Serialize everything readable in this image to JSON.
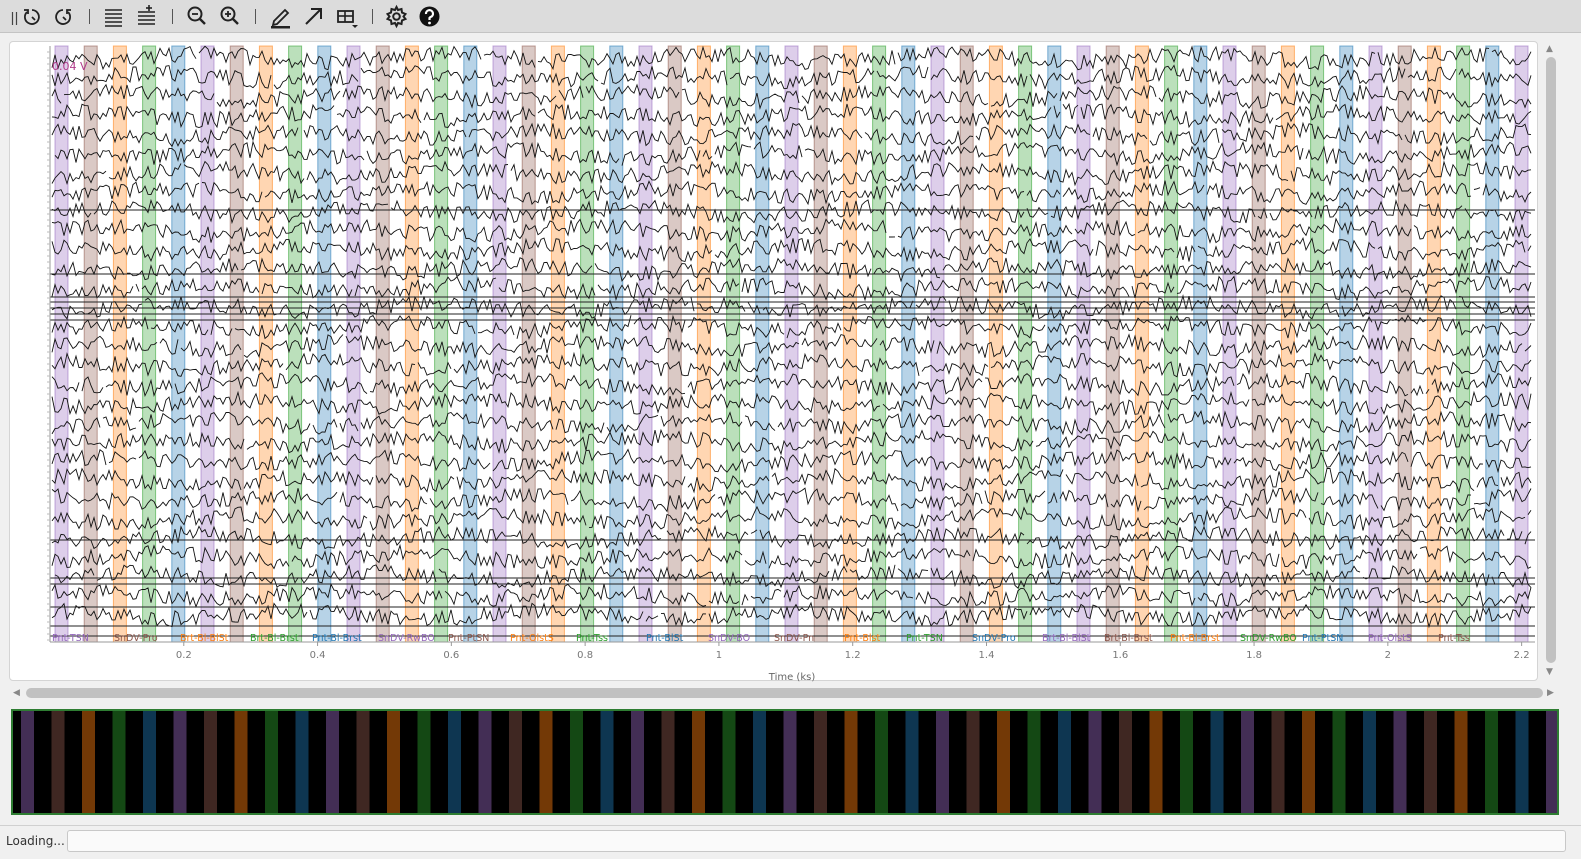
{
  "toolbar": {
    "buttons": [
      {
        "name": "pan-handle-icon",
        "icon": "grip-icon"
      },
      {
        "name": "undo-button",
        "icon": "rotate-left-icon"
      },
      {
        "name": "redo-button",
        "icon": "rotate-right-icon"
      },
      {
        "name": "compress-traces-button",
        "icon": "lines-icon"
      },
      {
        "name": "expand-traces-button",
        "icon": "lines-plus-icon"
      },
      {
        "name": "zoom-out-button",
        "icon": "zoom-out-icon"
      },
      {
        "name": "zoom-in-button",
        "icon": "zoom-in-icon"
      },
      {
        "name": "draw-tool-button",
        "icon": "pencil-icon"
      },
      {
        "name": "arrow-tool-button",
        "icon": "arrow-icon"
      },
      {
        "name": "layout-menu-button",
        "icon": "grid-dropdown-icon"
      },
      {
        "name": "settings-button",
        "icon": "gear-icon"
      },
      {
        "name": "help-button",
        "icon": "help-icon"
      }
    ]
  },
  "chart_data": {
    "type": "line",
    "title": "",
    "xlabel": "Time (ks)",
    "ylabel": "",
    "scale_label": "0.04 V",
    "x_ticks": [
      "0.2",
      "0.4",
      "0.6",
      "0.8",
      "1",
      "1.2",
      "1.4",
      "1.6",
      "1.8",
      "2",
      "2.2"
    ],
    "xlim": [
      0,
      2.22
    ],
    "channel_count": 30,
    "series_note": "stacked multichannel signal traces; individual values not legible",
    "annotation_labels": [
      "Pnt-TSN",
      "SnDV-Pro",
      "Brt-Bl-BlSt",
      "Brt-Bl-Brst",
      "Pnt-Bl-Brst",
      "SnDV-RwBO",
      "Pnt-PtSN",
      "Pnt-OlstS",
      "Pnt-Tss",
      "Pnt-BlSt",
      "SnDV-BO",
      "SnDV-Pn",
      "Pnt-Blst"
    ],
    "annotation_colors": {
      "purple": "#9467bd",
      "brown": "#8c564b",
      "orange": "#ff7f0e",
      "green": "#2ca02c",
      "blue": "#1f77b4"
    },
    "grid": false,
    "legend": "none"
  },
  "overview": {
    "border_color": "#2e7d32",
    "background": "#000000"
  },
  "status": {
    "text": "Loading..."
  }
}
